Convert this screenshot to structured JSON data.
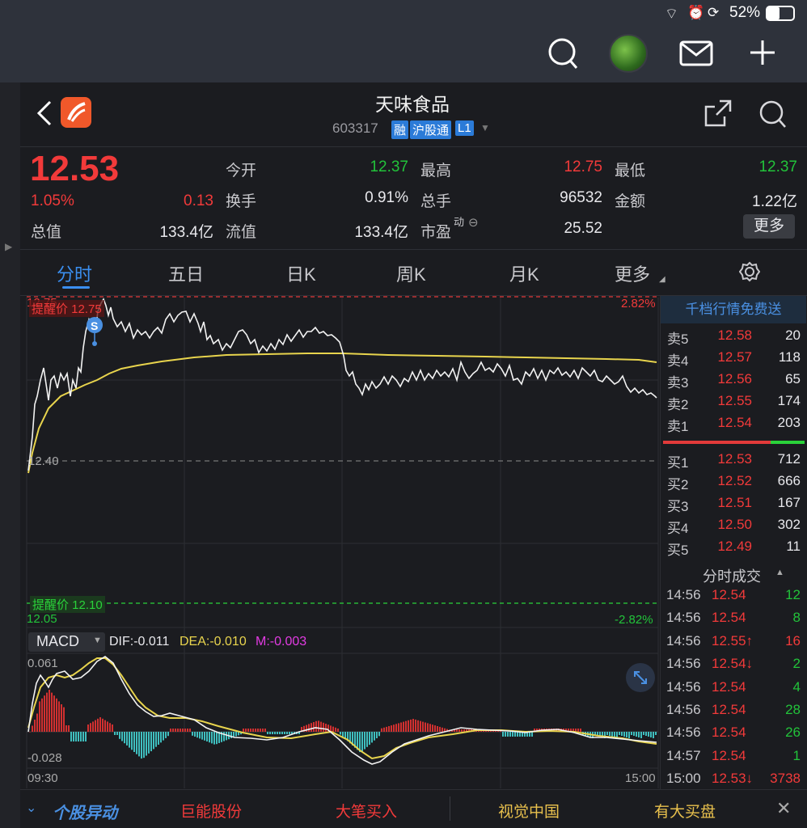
{
  "statusbar": {
    "battery": "52%"
  },
  "header": {
    "title": "天味食品",
    "code": "603317",
    "badge_rong": "融",
    "badge_hgt": "沪股通",
    "badge_level": "L1"
  },
  "quote": {
    "price": "12.53",
    "pct": "1.05%",
    "change": "0.13",
    "open_label": "今开",
    "open": "12.37",
    "high_label": "最高",
    "high": "12.75",
    "low_label": "最低",
    "low": "12.37",
    "turnover_label": "换手",
    "turnover": "0.91%",
    "volume_label": "总手",
    "volume": "96532",
    "amount_label": "金额",
    "amount": "1.22亿",
    "mktcap_label": "总值",
    "mktcap": "133.4亿",
    "float_label": "流值",
    "float": "133.4亿",
    "pe_label": "市盈",
    "pe_sup": "动",
    "pe": "25.52",
    "more_button": "更多"
  },
  "tabs": [
    "分时",
    "五日",
    "日K",
    "周K",
    "月K",
    "更多"
  ],
  "chart": {
    "top_price": "12.75",
    "top_pct": "2.82%",
    "alert_high": "提醒价 12.75",
    "mid_price": "12.40",
    "bottom_price": "12.05",
    "bottom_pct": "-2.82%",
    "alert_low": "提醒价 12.10",
    "marker": "S",
    "macd_select": "MACD",
    "dif": "DIF:-0.011",
    "dea": "DEA:-0.010",
    "m": "M:-0.003",
    "macd_top": "0.061",
    "macd_bottom": "-0.028",
    "time_start": "09:30",
    "time_end": "15:00"
  },
  "orderbook": {
    "promo": "千档行情免费送",
    "asks": [
      {
        "label": "卖5",
        "price": "12.58",
        "vol": "20"
      },
      {
        "label": "卖4",
        "price": "12.57",
        "vol": "118"
      },
      {
        "label": "卖3",
        "price": "12.56",
        "vol": "65"
      },
      {
        "label": "卖2",
        "price": "12.55",
        "vol": "174"
      },
      {
        "label": "卖1",
        "price": "12.54",
        "vol": "203"
      }
    ],
    "bids": [
      {
        "label": "买1",
        "price": "12.53",
        "vol": "712"
      },
      {
        "label": "买2",
        "price": "12.52",
        "vol": "666"
      },
      {
        "label": "买3",
        "price": "12.51",
        "vol": "167"
      },
      {
        "label": "买4",
        "price": "12.50",
        "vol": "302"
      },
      {
        "label": "买5",
        "price": "12.49",
        "vol": "11"
      }
    ],
    "trades_title": "分时成交",
    "trades": [
      {
        "time": "14:56",
        "price": "12.54",
        "vol": "12",
        "vcolor": "#22c33a"
      },
      {
        "time": "14:56",
        "price": "12.54",
        "vol": "8",
        "vcolor": "#22c33a"
      },
      {
        "time": "14:56",
        "price": "12.55↑",
        "vol": "16",
        "vcolor": "#f23a3a"
      },
      {
        "time": "14:56",
        "price": "12.54↓",
        "vol": "2",
        "vcolor": "#22c33a"
      },
      {
        "time": "14:56",
        "price": "12.54",
        "vol": "4",
        "vcolor": "#22c33a"
      },
      {
        "time": "14:56",
        "price": "12.54",
        "vol": "28",
        "vcolor": "#22c33a"
      },
      {
        "time": "14:56",
        "price": "12.54",
        "vol": "26",
        "vcolor": "#22c33a"
      },
      {
        "time": "14:57",
        "price": "12.54",
        "vol": "1",
        "vcolor": "#22c33a"
      },
      {
        "time": "15:00",
        "price": "12.53↓",
        "vol": "3738",
        "vcolor": "#f23a3a"
      }
    ]
  },
  "ticker": {
    "label": "个股异动",
    "items": [
      "巨能股份",
      "大笔买入",
      "视觉中国",
      "有大买盘"
    ]
  }
}
